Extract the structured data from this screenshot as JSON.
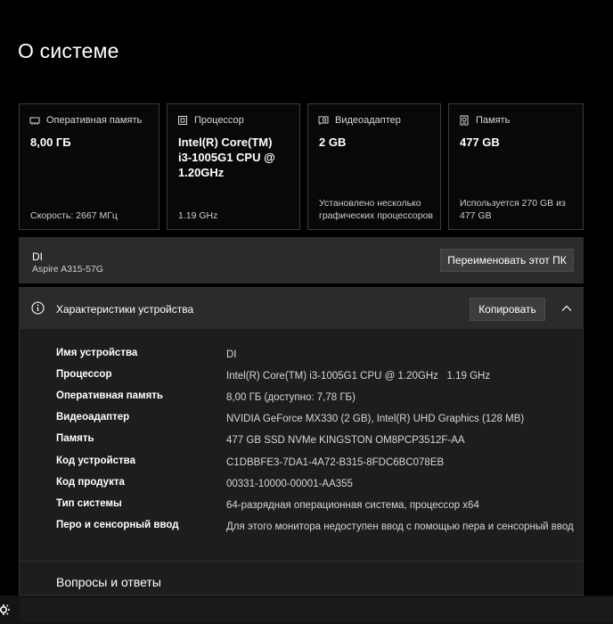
{
  "page": {
    "title": "О системе"
  },
  "cards": [
    {
      "icon": "memory-icon",
      "label": "Оперативная память",
      "value": "8,00 ГБ",
      "footer": "Скорость: 2667 МГц"
    },
    {
      "icon": "processor-icon",
      "label": "Процессор",
      "value": "Intel(R) Core(TM) i3-1005G1 CPU @ 1.20GHz",
      "footer": "1.19 GHz"
    },
    {
      "icon": "gpu-icon",
      "label": "Видеоадаптер",
      "value": "2 GB",
      "footer": "Установлено несколько графических процессоров"
    },
    {
      "icon": "storage-icon",
      "label": "Память",
      "value": "477 GB",
      "footer": "Используется 270 GB из 477 GB"
    }
  ],
  "device": {
    "name": "DI",
    "model": "Aspire A315-57G",
    "rename_label": "Переименовать этот ПК"
  },
  "specs": {
    "title": "Характеристики устройства",
    "copy_label": "Копировать",
    "rows": [
      {
        "label": "Имя устройства",
        "value": "DI"
      },
      {
        "label": "Процессор",
        "value": "Intel(R) Core(TM) i3-1005G1 CPU @ 1.20GHz   1.19 GHz"
      },
      {
        "label": "Оперативная память",
        "value": "8,00 ГБ (доступно: 7,78 ГБ)"
      },
      {
        "label": "Видеоадаптер",
        "value": "NVIDIA GeForce MX330 (2 GB), Intel(R) UHD Graphics (128 MB)"
      },
      {
        "label": "Память",
        "value": "477 GB SSD NVMe KINGSTON OM8PCP3512F-AA"
      },
      {
        "label": "Код устройства",
        "value": "C1DBBFE3-7DA1-4A72-B315-8FDC6BC078EB"
      },
      {
        "label": "Код продукта",
        "value": "00331-10000-00001-AA355"
      },
      {
        "label": "Тип системы",
        "value": "64-разрядная операционная система, процессор x64"
      },
      {
        "label": "Перо и сенсорный ввод",
        "value": "Для этого монитора недоступен ввод с помощью пера и сенсорный ввод"
      }
    ]
  },
  "faq": {
    "title": "Вопросы и ответы"
  },
  "taskbar": {
    "icon": "gear-icon"
  },
  "colors": {
    "background": "#000000",
    "panel": "#2b2b2b",
    "section": "#1d1d1d",
    "button": "#3d3d3d",
    "text": "#ffffff",
    "muted": "#cfcfcf"
  }
}
